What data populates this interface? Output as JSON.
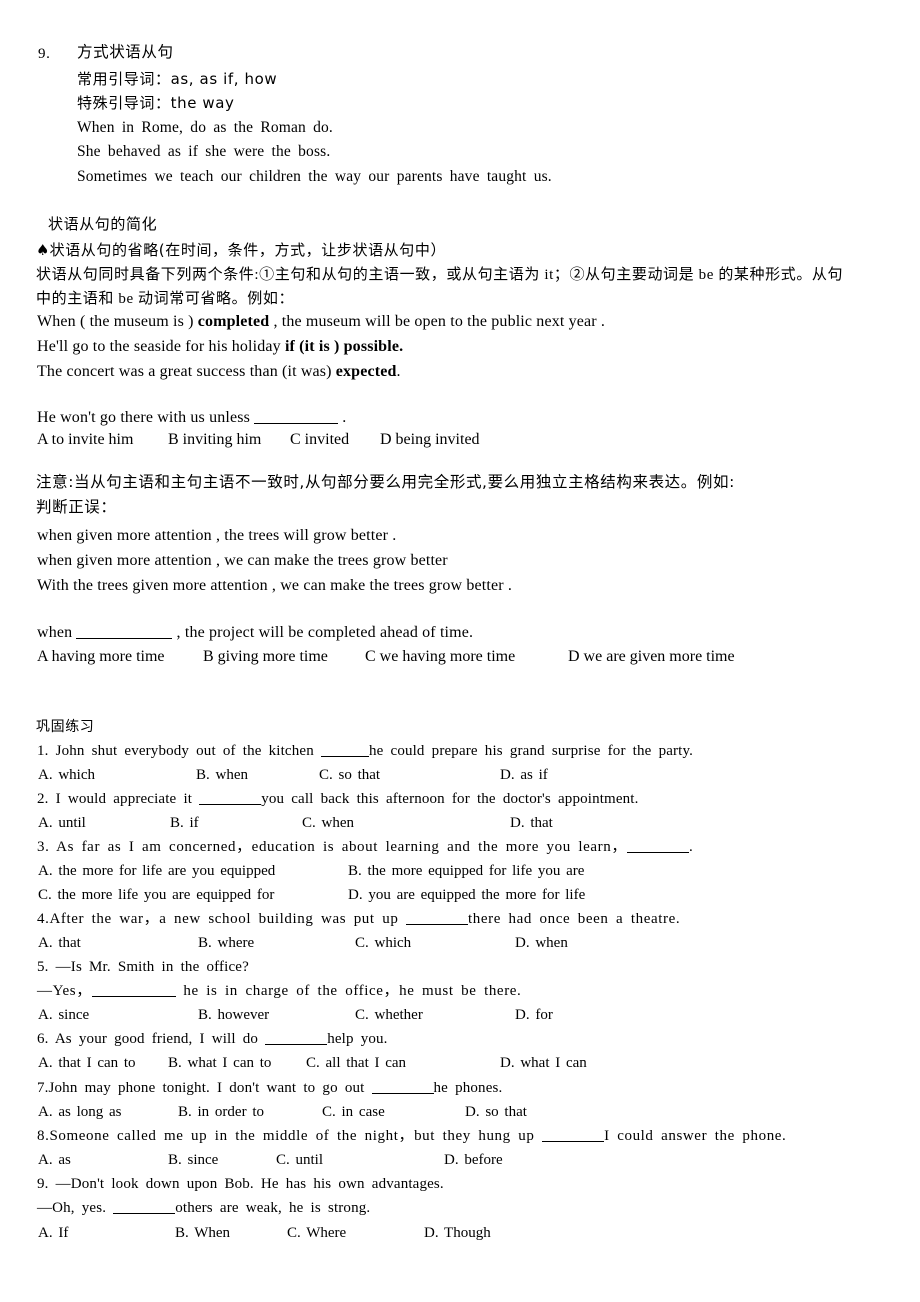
{
  "document": {
    "section_number": "9.",
    "section_title": "方式状语从句",
    "intro_lines": [
      "常用引导词：as, as if, how",
      "特殊引导词：the way",
      "When in Rome, do as the Roman do.",
      "She behaved as if she were the boss.",
      "Sometimes we teach our children the way our parents have taught us."
    ],
    "simplification": {
      "heading": "状语从句的简化",
      "bullet_symbol": "♠",
      "bullet_heading": "状语从句的省略(在时间，条件，方式，让步状语从句中）",
      "rule_line1": "状语从句同时具备下列两个条件:①主句和从句的主语一致，或从句主语为 it；②从句主要动词是 be 的某种形式。从句",
      "rule_line2": "中的主语和 be 动词常可省略。例如："
    },
    "examples": [
      {
        "pre": "When ( the museum is ) ",
        "bold": "completed",
        "post": " , the museum will be open to the public next year ."
      },
      {
        "pre": "He'll go to the seaside for his holiday ",
        "bold": "if (it is ) possible.",
        "post": ""
      },
      {
        "pre": "The concert was a great success than (it was) ",
        "bold": "expected",
        "post": "."
      }
    ],
    "practice_q1": {
      "stem_pre": "He won't go there with us unless ",
      "stem_post": " .",
      "options": [
        "A to invite him",
        "B inviting him",
        "C invited",
        "D being invited"
      ]
    },
    "note": {
      "line1": "注意:当从句主语和主句主语不一致时,从句部分要么用完全形式,要么用独立主格结构来表达。例如:",
      "line2": "判断正误："
    },
    "judge_lines": [
      "when given more attention , the trees will grow better .",
      "when given more attention , we can make the trees grow better",
      "With the trees given more attention , we can make the trees grow better ."
    ],
    "practice_q2": {
      "stem_pre": "when ",
      "stem_post": " , the project will be completed ahead of time.",
      "options": [
        "A having more time",
        "B giving more time",
        "C we having more time",
        "D we are given more time"
      ]
    },
    "exercises": {
      "heading": "巩固练习",
      "items": [
        {
          "number": "1.",
          "stem_pre": "1. John shut everybody out of the kitchen ",
          "stem_post": "he could prepare his grand surprise for the party.",
          "blank": "sm",
          "options": [
            "A. which",
            "B. when",
            "C. so that",
            "D. as if"
          ],
          "option_cols": [
            38,
            196,
            319,
            500
          ]
        },
        {
          "number": "2.",
          "stem_pre": "2. I would appreciate it ",
          "stem_post": "you call back this afternoon for the doctor's appointment.",
          "blank": "md",
          "options": [
            "A. until",
            "B. if",
            "C. when",
            "D. that"
          ],
          "option_cols": [
            38,
            170,
            302,
            510
          ]
        },
        {
          "number": "3.",
          "stem_pre": "3. As far as I am concerned，education is about learning and the more you learn，",
          "stem_post": ".",
          "blank": "md",
          "options": [
            "A. the more for life are you equipped",
            "B. the more equipped for life you are",
            "C. the more life you are equipped for",
            "D. you are equipped the more for life"
          ],
          "option_cols": [
            38,
            348,
            38,
            348
          ]
        },
        {
          "number": "4.",
          "stem_pre": "4.After the war，a new school building was put up ",
          "stem_post": "there had once been a theatre.",
          "blank": "md",
          "options": [
            "A. that",
            "B. where",
            "C. which",
            "D. when"
          ],
          "option_cols": [
            38,
            198,
            355,
            515
          ]
        },
        {
          "number": "5.",
          "stem_pre": "5. —Is Mr. Smith in the office?",
          "stem_post": "",
          "sub_pre": "—Yes，",
          "sub_post": " he is in charge of the office，he must be there.",
          "blank": "lg",
          "options": [
            "A. since",
            "B. however",
            "C. whether",
            "D. for"
          ],
          "option_cols": [
            38,
            198,
            355,
            515
          ]
        },
        {
          "number": "6.",
          "stem_pre": "6. As your good friend, I will do ",
          "stem_post": "help you.",
          "blank": "md",
          "options": [
            "A. that I can to",
            "B. what I can to",
            "C. all that I can",
            "D. what I can"
          ],
          "option_cols": [
            38,
            168,
            306,
            500
          ]
        },
        {
          "number": "7.",
          "stem_pre": "7.John may phone tonight. I don't want to go out ",
          "stem_post": "he phones.",
          "blank": "md",
          "options": [
            "A. as long as",
            "B. in order to",
            "C. in case",
            "D. so that"
          ],
          "option_cols": [
            38,
            178,
            322,
            465
          ]
        },
        {
          "number": "8.",
          "stem_pre": "8.Someone called me up in the middle of the night，but they hung up ",
          "stem_post": "I could answer the phone.",
          "blank": "md",
          "options": [
            "A. as",
            "B. since",
            "C. until",
            "D. before"
          ],
          "option_cols": [
            38,
            168,
            276,
            444
          ]
        },
        {
          "number": "9.",
          "stem_pre": "9. —Don't look down upon Bob. He has his own advantages.",
          "stem_post": "",
          "sub_pre": "—Oh, yes. ",
          "sub_post": "others are weak, he is strong.",
          "blank": "md",
          "options": [
            "A. If",
            "B. When",
            "C. Where",
            "D. Though"
          ],
          "option_cols": [
            38,
            175,
            287,
            424
          ]
        }
      ]
    }
  }
}
